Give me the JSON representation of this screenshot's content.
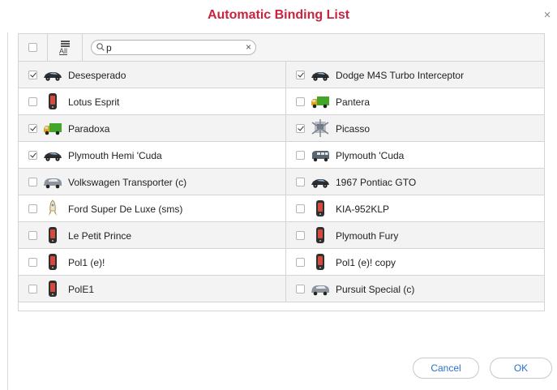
{
  "dialog": {
    "title": "Automatic Binding List",
    "close_glyph": "×"
  },
  "toolbar": {
    "all_label": "All",
    "search": {
      "value": "p",
      "clear_glyph": "×"
    }
  },
  "items": [
    {
      "label": "Desesperado",
      "checked": true,
      "icon": "car-icon"
    },
    {
      "label": "Dodge M4S Turbo Interceptor",
      "checked": true,
      "icon": "car-icon"
    },
    {
      "label": "Lotus Esprit",
      "checked": false,
      "icon": "phone-icon"
    },
    {
      "label": "Pantera",
      "checked": false,
      "icon": "truck-icon"
    },
    {
      "label": "Paradoxa",
      "checked": true,
      "icon": "truck-icon"
    },
    {
      "label": "Picasso",
      "checked": true,
      "icon": "robot-icon"
    },
    {
      "label": "Plymouth Hemi 'Cuda",
      "checked": true,
      "icon": "car-icon"
    },
    {
      "label": "Plymouth 'Cuda",
      "checked": false,
      "icon": "bus-icon"
    },
    {
      "label": "Volkswagen Transporter (c)",
      "checked": false,
      "icon": "van-icon"
    },
    {
      "label": "1967 Pontiac GTO",
      "checked": false,
      "icon": "car-icon"
    },
    {
      "label": "Ford Super De Luxe (sms)",
      "checked": false,
      "icon": "rocket-icon"
    },
    {
      "label": "KIA-952KLP",
      "checked": false,
      "icon": "phone-icon"
    },
    {
      "label": "Le Petit Prince",
      "checked": false,
      "icon": "phone-icon"
    },
    {
      "label": "Plymouth Fury",
      "checked": false,
      "icon": "phone-icon"
    },
    {
      "label": "Pol1 (e)!",
      "checked": false,
      "icon": "phone-icon"
    },
    {
      "label": "Pol1 (e)! copy",
      "checked": false,
      "icon": "phone-icon"
    },
    {
      "label": "PolE1",
      "checked": false,
      "icon": "phone-icon"
    },
    {
      "label": "Pursuit Special (c)",
      "checked": false,
      "icon": "van-icon"
    }
  ],
  "footer": {
    "cancel_label": "Cancel",
    "ok_label": "OK"
  }
}
